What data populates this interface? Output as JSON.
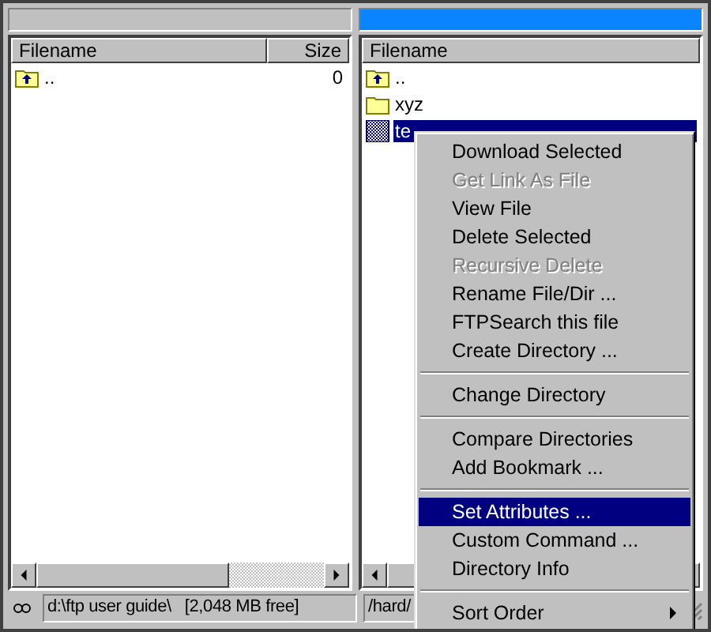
{
  "panes": [
    {
      "active": false,
      "columns": [
        "Filename",
        "Size"
      ],
      "rows": [
        {
          "kind": "parent",
          "name": "..",
          "size": "0",
          "selected": false
        }
      ],
      "path": "d:\\ftp user guide\\   [2,048 MB free]"
    },
    {
      "active": true,
      "columns": [
        "Filename"
      ],
      "rows": [
        {
          "kind": "parent",
          "name": "..",
          "selected": false
        },
        {
          "kind": "folder",
          "name": "xyz",
          "selected": false
        },
        {
          "kind": "file",
          "name": "te",
          "selected": true
        }
      ],
      "path": "/hard/"
    }
  ],
  "context_menu": [
    {
      "kind": "item",
      "label": "Download Selected",
      "disabled": false,
      "selected": false
    },
    {
      "kind": "item",
      "label": "Get Link As File",
      "disabled": true,
      "selected": false
    },
    {
      "kind": "item",
      "label": "View File",
      "disabled": false,
      "selected": false
    },
    {
      "kind": "item",
      "label": "Delete Selected",
      "disabled": false,
      "selected": false
    },
    {
      "kind": "item",
      "label": "Recursive Delete",
      "disabled": true,
      "selected": false
    },
    {
      "kind": "item",
      "label": "Rename File/Dir ...",
      "disabled": false,
      "selected": false
    },
    {
      "kind": "item",
      "label": "FTPSearch this file",
      "disabled": false,
      "selected": false
    },
    {
      "kind": "item",
      "label": "Create Directory ...",
      "disabled": false,
      "selected": false
    },
    {
      "kind": "separator"
    },
    {
      "kind": "item",
      "label": "Change Directory",
      "disabled": false,
      "selected": false
    },
    {
      "kind": "separator"
    },
    {
      "kind": "item",
      "label": "Compare Directories",
      "disabled": false,
      "selected": false
    },
    {
      "kind": "item",
      "label": "Add Bookmark ...",
      "disabled": false,
      "selected": false
    },
    {
      "kind": "separator"
    },
    {
      "kind": "item",
      "label": "Set Attributes ...",
      "disabled": false,
      "selected": true
    },
    {
      "kind": "item",
      "label": "Custom Command ...",
      "disabled": false,
      "selected": false
    },
    {
      "kind": "item",
      "label": "Directory Info",
      "disabled": false,
      "selected": false
    },
    {
      "kind": "separator"
    },
    {
      "kind": "submenu",
      "label": "Sort Order",
      "disabled": false,
      "selected": false
    }
  ]
}
